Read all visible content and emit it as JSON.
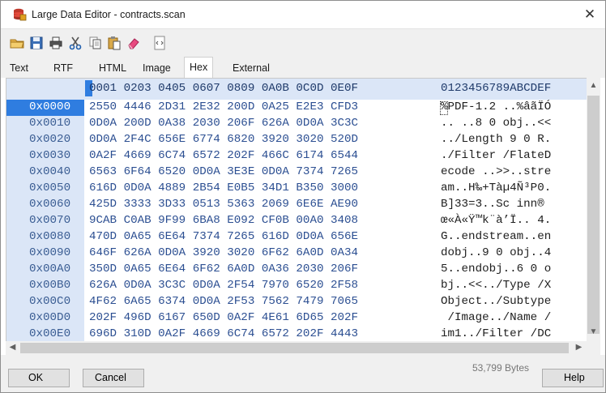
{
  "window": {
    "title": "Large Data Editor - contracts.scan",
    "close_glyph": "✕"
  },
  "toolbar": {
    "icons": [
      "open-folder-icon",
      "save-icon",
      "print-icon",
      "cut-icon",
      "copy-icon",
      "paste-icon",
      "eraser-icon",
      "script-icon"
    ]
  },
  "tabs": [
    "Text",
    "RTF",
    "HTML",
    "Image",
    "Hex",
    "External"
  ],
  "active_tab": "Hex",
  "hex": {
    "header_hex": "0001 0203 0405 0607 0809 0A0B 0C0D 0E0F",
    "header_ascii": "0123456789ABCDEF",
    "rows": [
      {
        "addr": "0x0000",
        "hex": "2550 4446 2D31 2E32 200D 0A25 E2E3 CFD3",
        "ascii": "%PDF-1.2 ..%âãÏÓ"
      },
      {
        "addr": "0x0010",
        "hex": "0D0A 200D 0A38 2030 206F 626A 0D0A 3C3C",
        "ascii": ".. ..8 0 obj..<<"
      },
      {
        "addr": "0x0020",
        "hex": "0D0A 2F4C 656E 6774 6820 3920 3020 520D",
        "ascii": "../Length 9 0 R."
      },
      {
        "addr": "0x0030",
        "hex": "0A2F 4669 6C74 6572 202F 466C 6174 6544",
        "ascii": "./Filter /FlateD"
      },
      {
        "addr": "0x0040",
        "hex": "6563 6F64 6520 0D0A 3E3E 0D0A 7374 7265",
        "ascii": "ecode ..>>..stre"
      },
      {
        "addr": "0x0050",
        "hex": "616D 0D0A 4889 2B54 E0B5 34D1 B350 3000",
        "ascii": "am..H‰+Tàµ4Ñ³P0."
      },
      {
        "addr": "0x0060",
        "hex": "425D 3333 3D33 0513 5363 2069 6E6E AE90",
        "ascii": "B]33=3..Sc inn®"
      },
      {
        "addr": "0x0070",
        "hex": "9CAB C0AB 9F99 6BA8 E092 CF0B 00A0 3408",
        "ascii": "œ«À«Ÿ™k¨à’Ï.. 4."
      },
      {
        "addr": "0x0080",
        "hex": "470D 0A65 6E64 7374 7265 616D 0D0A 656E",
        "ascii": "G..endstream..en"
      },
      {
        "addr": "0x0090",
        "hex": "646F 626A 0D0A 3920 3020 6F62 6A0D 0A34",
        "ascii": "dobj..9 0 obj..4"
      },
      {
        "addr": "0x00A0",
        "hex": "350D 0A65 6E64 6F62 6A0D 0A36 2030 206F",
        "ascii": "5..endobj..6 0 o"
      },
      {
        "addr": "0x00B0",
        "hex": "626A 0D0A 3C3C 0D0A 2F54 7970 6520 2F58",
        "ascii": "bj..<<../Type /X"
      },
      {
        "addr": "0x00C0",
        "hex": "4F62 6A65 6374 0D0A 2F53 7562 7479 7065",
        "ascii": "Object../Subtype"
      },
      {
        "addr": "0x00D0",
        "hex": "202F 496D 6167 650D 0A2F 4E61 6D65 202F",
        "ascii": " /Image../Name /"
      },
      {
        "addr": "0x00E0",
        "hex": "696D 310D 0A2F 4669 6C74 6572 202F 4443",
        "ascii": "im1../Filter /DC"
      }
    ]
  },
  "status": {
    "size": "53,799 Bytes"
  },
  "buttons": {
    "ok": "OK",
    "cancel": "Cancel",
    "help": "Help"
  },
  "colors": {
    "header_bg": "#dbe6f7",
    "selection": "#2f7de0",
    "hex_text": "#2c4f92"
  }
}
